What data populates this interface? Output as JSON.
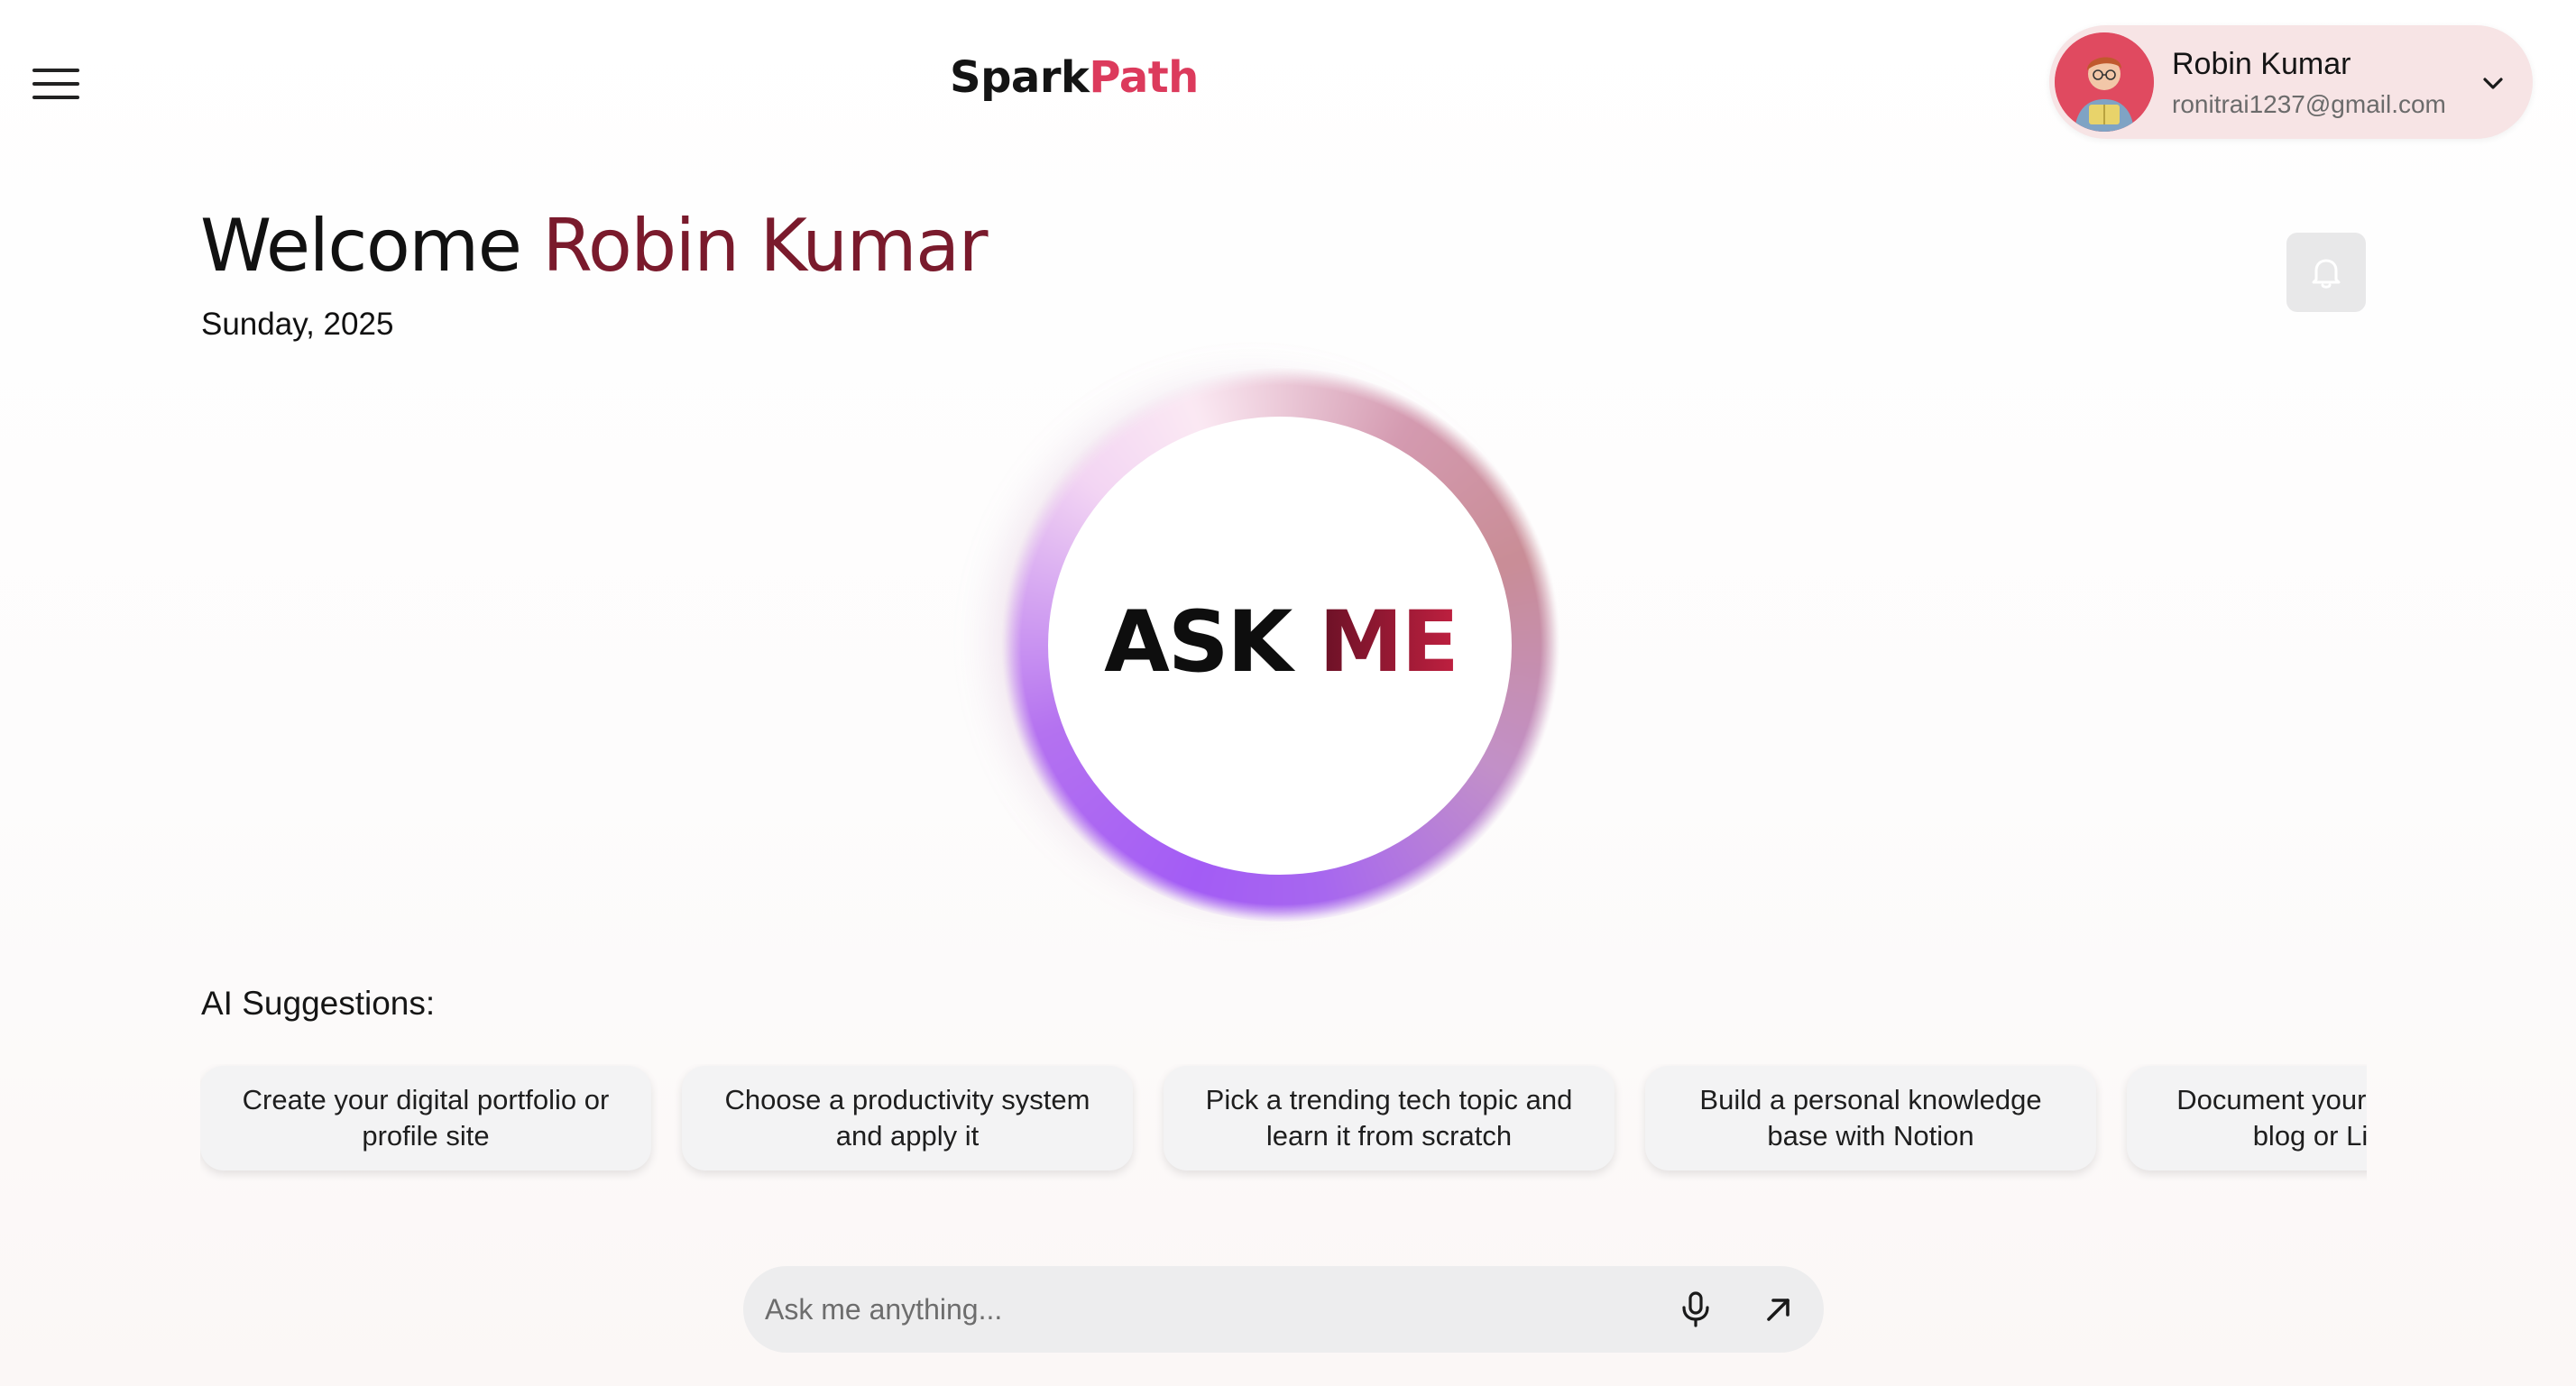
{
  "header": {
    "menu_icon": "hamburger-menu-icon",
    "brand_part1": "Spark",
    "brand_part2": "Path",
    "brand_accent_color": "#dc3a5c",
    "profile": {
      "name": "Robin Kumar",
      "email": "ronitrai1237@gmail.com",
      "chevron_icon": "chevron-down-icon"
    }
  },
  "welcome": {
    "greeting": "Welcome",
    "name": "Robin Kumar",
    "date": "Sunday, 2025",
    "bell_icon": "bell-icon"
  },
  "orb": {
    "label_part1": "ASK",
    "label_part2": "ME"
  },
  "suggestions": {
    "label": "AI Suggestions:",
    "items": [
      "Create your digital portfolio or profile site",
      "Choose a productivity system and apply it",
      "Pick a trending tech topic and learn it from scratch",
      "Build a personal knowledge base with Notion",
      "Document your journey on a blog or LinkedIn"
    ]
  },
  "ask_bar": {
    "placeholder": "Ask me anything...",
    "mic_icon": "microphone-icon",
    "send_icon": "arrow-up-right-icon"
  }
}
